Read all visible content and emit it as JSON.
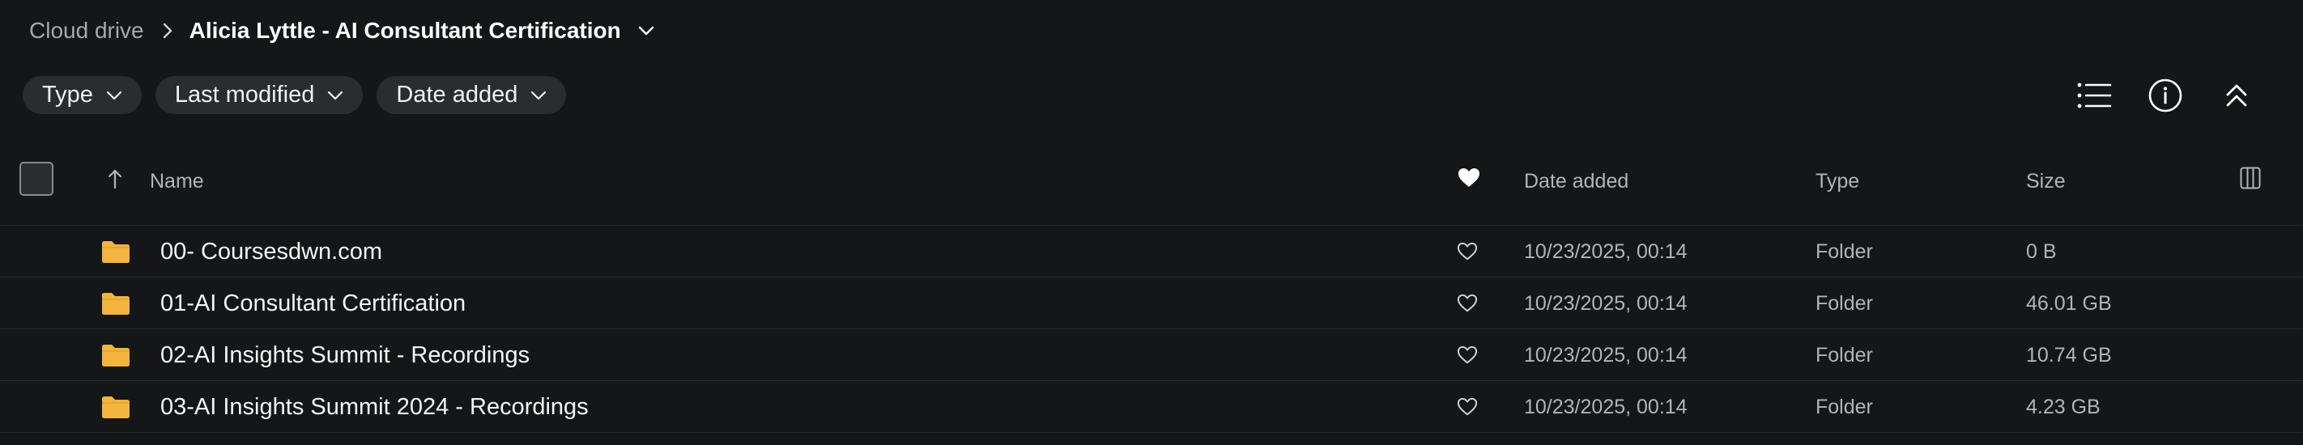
{
  "breadcrumb": {
    "root": "Cloud drive",
    "current": "Alicia Lyttle - AI Consultant Certification"
  },
  "filters": [
    {
      "label": "Type"
    },
    {
      "label": "Last modified"
    },
    {
      "label": "Date added"
    }
  ],
  "table": {
    "headers": {
      "name": "Name",
      "date_added": "Date added",
      "type": "Type",
      "size": "Size"
    },
    "rows": [
      {
        "name": "00- Coursesdwn.com",
        "date_added": "10/23/2025, 00:14",
        "type": "Folder",
        "size": "0 B"
      },
      {
        "name": "01-AI Consultant Certification",
        "date_added": "10/23/2025, 00:14",
        "type": "Folder",
        "size": "46.01 GB"
      },
      {
        "name": "02-AI Insights Summit - Recordings",
        "date_added": "10/23/2025, 00:14",
        "type": "Folder",
        "size": "10.74 GB"
      },
      {
        "name": "03-AI Insights Summit 2024 - Recordings",
        "date_added": "10/23/2025, 00:14",
        "type": "Folder",
        "size": "4.23 GB"
      }
    ]
  },
  "colors": {
    "background": "#141617",
    "chip_background": "#2a2c2e",
    "folder": "#f3b440",
    "divider": "#26292b"
  },
  "icons": {
    "breadcrumb_separator": "chevron-right-icon",
    "breadcrumb_dropdown": "chevron-down-icon",
    "list_view": "list-view-icon",
    "info": "info-icon",
    "collapse": "collapse-up-icon",
    "sort": "arrow-up-icon",
    "favorite_header": "heart-filled-icon",
    "favorite_row": "heart-outline-icon",
    "columns": "columns-icon",
    "folder": "folder-icon"
  }
}
